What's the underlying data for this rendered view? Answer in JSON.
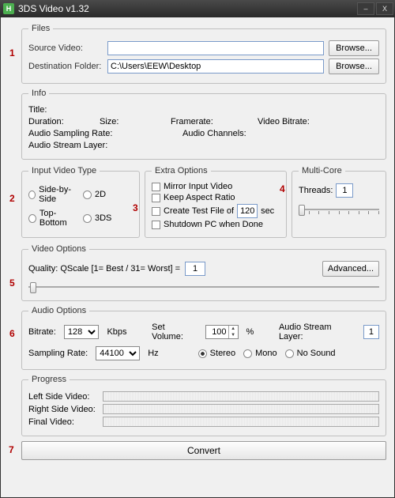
{
  "window": {
    "title": "3DS Video v1.32",
    "min": "–",
    "close": "X"
  },
  "markers": {
    "m1": "1",
    "m2": "2",
    "m3": "3",
    "m4": "4",
    "m5": "5",
    "m6": "6",
    "m7": "7"
  },
  "files": {
    "legend": "Files",
    "source_label": "Source Video:",
    "source_value": "",
    "source_placeholder": "",
    "dest_label": "Destination Folder:",
    "dest_value": "C:\\Users\\EEW\\Desktop",
    "browse_label": "Browse..."
  },
  "info": {
    "legend": "Info",
    "title_label": "Title:",
    "duration_label": "Duration:",
    "size_label": "Size:",
    "framerate_label": "Framerate:",
    "bitrate_label": "Video Bitrate:",
    "audio_sampling_label": "Audio Sampling Rate:",
    "audio_channels_label": "Audio Channels:",
    "audio_stream_layer_label": "Audio Stream Layer:"
  },
  "input_type": {
    "legend": "Input Video Type",
    "opts": [
      "Side-by-Side",
      "2D",
      "Top-Bottom",
      "3DS"
    ]
  },
  "extra": {
    "legend": "Extra Options",
    "mirror": "Mirror Input Video",
    "keep_aspect": "Keep Aspect Ratio",
    "create_test_prefix": "Create Test File of",
    "create_test_value": "120",
    "create_test_suffix": "sec",
    "shutdown": "Shutdown PC when Done"
  },
  "multicore": {
    "legend": "Multi-Core",
    "threads_label": "Threads:",
    "threads_value": "1"
  },
  "video_opts": {
    "legend": "Video Options",
    "quality_label": "Quality:  QScale [1= Best / 31= Worst]  =",
    "quality_value": "1",
    "advanced_label": "Advanced..."
  },
  "audio_opts": {
    "legend": "Audio Options",
    "bitrate_label": "Bitrate:",
    "bitrate_value": "128",
    "kbps": "Kbps",
    "volume_label": "Set Volume:",
    "volume_value": "100",
    "percent": "%",
    "stream_layer_label": "Audio Stream Layer:",
    "stream_layer_value": "1",
    "sampling_label": "Sampling Rate:",
    "sampling_value": "44100",
    "hz": "Hz",
    "modes": [
      "Stereo",
      "Mono",
      "No Sound"
    ]
  },
  "progress": {
    "legend": "Progress",
    "left": "Left Side Video:",
    "right": "Right Side Video:",
    "final": "Final Video:"
  },
  "convert_label": "Convert"
}
